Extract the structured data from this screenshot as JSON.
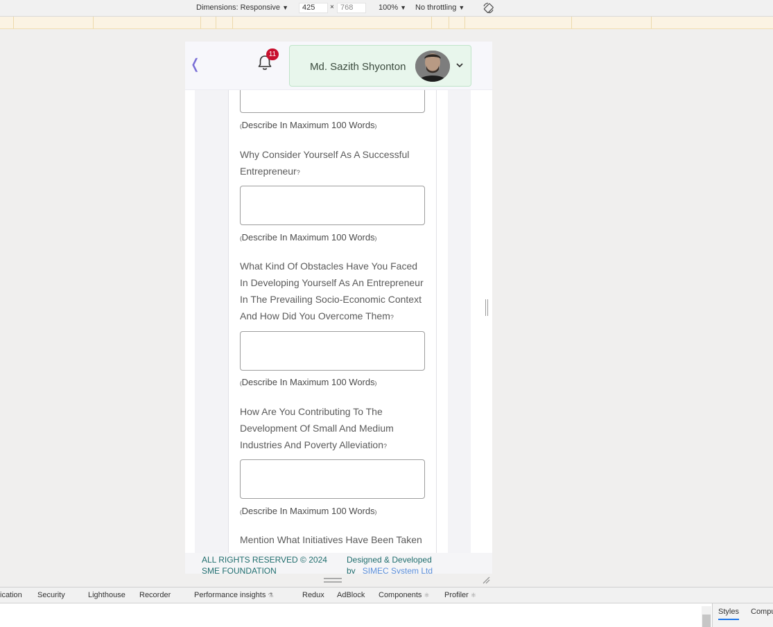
{
  "devtools": {
    "dimensions_label": "Dimensions: Responsive",
    "width": "425",
    "height": "768",
    "zoom": "100%",
    "throttling": "No throttling",
    "tabs": [
      "ication",
      "Security",
      "Lighthouse",
      "Recorder",
      "Performance insights",
      "Redux",
      "AdBlock",
      "Components",
      "Profiler"
    ],
    "styles_tab": "Styles",
    "computed_tab": "Compu"
  },
  "header": {
    "notification_count": "11",
    "user_name": "Md. Sazith Shyonton"
  },
  "form": {
    "hint_text": "Describe In Maximum 100 Words",
    "questions": [
      {
        "label": "Why Consider Yourself As A Successful Entrepreneur"
      },
      {
        "label": "What Kind Of Obstacles Have You Faced In Developing Yourself As An Entrepreneur In The Prevailing Socio-Economic Context And How Did You Overcome Them"
      },
      {
        "label": "How Are You Contributing To The Development Of Small And Medium Industries And Poverty Alleviation"
      },
      {
        "label": "Mention What Initiatives Have Been Taken"
      }
    ]
  },
  "footer": {
    "rights": "ALL RIGHTS RESERVED © 2024",
    "org": "SME FOUNDATION",
    "designed_by": "Designed & Developed",
    "by": "by",
    "company": "SIMEC System Ltd"
  },
  "colors": {
    "accent": "#7a6fd6",
    "badge": "#c8102e",
    "user_card_bg": "#e8f6ec",
    "footer_text": "#1f6d6d",
    "link": "#5b8fd9"
  }
}
